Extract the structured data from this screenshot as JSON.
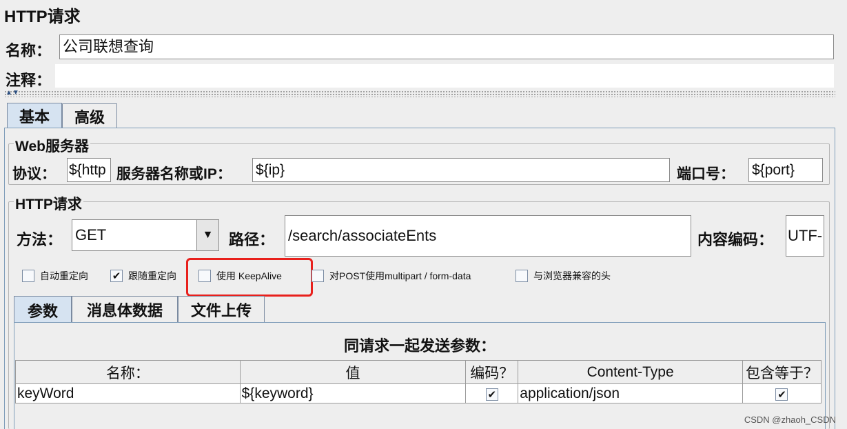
{
  "title": "HTTP请求",
  "name_label": "名称：",
  "name_value": "公司联想查询",
  "comment_label": "注释：",
  "comment_value": "",
  "tabs": [
    {
      "label": "基本",
      "active": true
    },
    {
      "label": "高级",
      "active": false
    }
  ],
  "web_server": {
    "title": "Web服务器",
    "protocol_label": "协议：",
    "protocol_value": "${http",
    "server_label": "服务器名称或IP：",
    "server_value": "${ip}",
    "port_label": "端口号：",
    "port_value": "${port}"
  },
  "http_request": {
    "title": "HTTP请求",
    "method_label": "方法：",
    "method_value": "GET",
    "path_label": "路径：",
    "path_value": "/search/associateEnts",
    "encoding_label": "内容编码：",
    "encoding_value": "UTF-"
  },
  "checkboxes": [
    {
      "label": "自动重定向",
      "checked": false
    },
    {
      "label": "跟随重定向",
      "checked": true
    },
    {
      "label": "使用 KeepAlive",
      "checked": false
    },
    {
      "label": "对POST使用multipart / form-data",
      "checked": false
    },
    {
      "label": "与浏览器兼容的头",
      "checked": false
    }
  ],
  "sub_tabs": [
    {
      "label": "参数",
      "active": true
    },
    {
      "label": "消息体数据",
      "active": false
    },
    {
      "label": "文件上传",
      "active": false
    }
  ],
  "params": {
    "heading": "同请求一起发送参数：",
    "columns": [
      "名称：",
      "值",
      "编码？",
      "Content-Type",
      "包含等于？"
    ],
    "rows": [
      {
        "name": "keyWord",
        "value": "${keyword}",
        "encode": true,
        "content_type": "application/json",
        "include_equals": true
      }
    ]
  },
  "credit": "CSDN @zhaoh_CSDN",
  "colors": {
    "highlight": "#e8201c",
    "active_tab": "#d6e3f1"
  }
}
